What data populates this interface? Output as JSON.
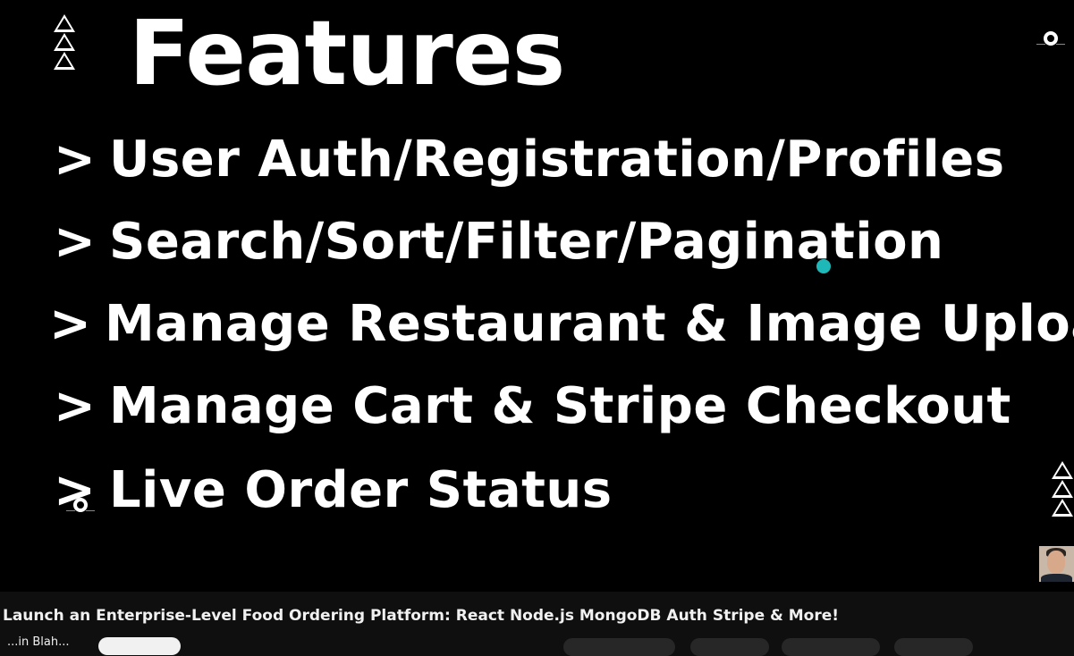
{
  "slide": {
    "title": "Features",
    "items": [
      {
        "arrow": ">",
        "text": "User Auth/Registration/Profiles"
      },
      {
        "arrow": ">",
        "text": "Search/Sort/Filter/Pagination"
      },
      {
        "arrow": ">",
        "text": "Manage Restaurant & Image Upload"
      },
      {
        "arrow": ">",
        "text": "Manage Cart & Stripe Checkout"
      },
      {
        "arrow": ">",
        "text": "Live Order Status"
      }
    ]
  },
  "video": {
    "title": "Launch an Enterprise-Level Food Ordering Platform: React Node.js MongoDB Auth Stripe & More!",
    "channel": "...in Blah..."
  },
  "colors": {
    "background": "#000000",
    "text": "#ffffff",
    "cursor": "#1fb8b8"
  }
}
